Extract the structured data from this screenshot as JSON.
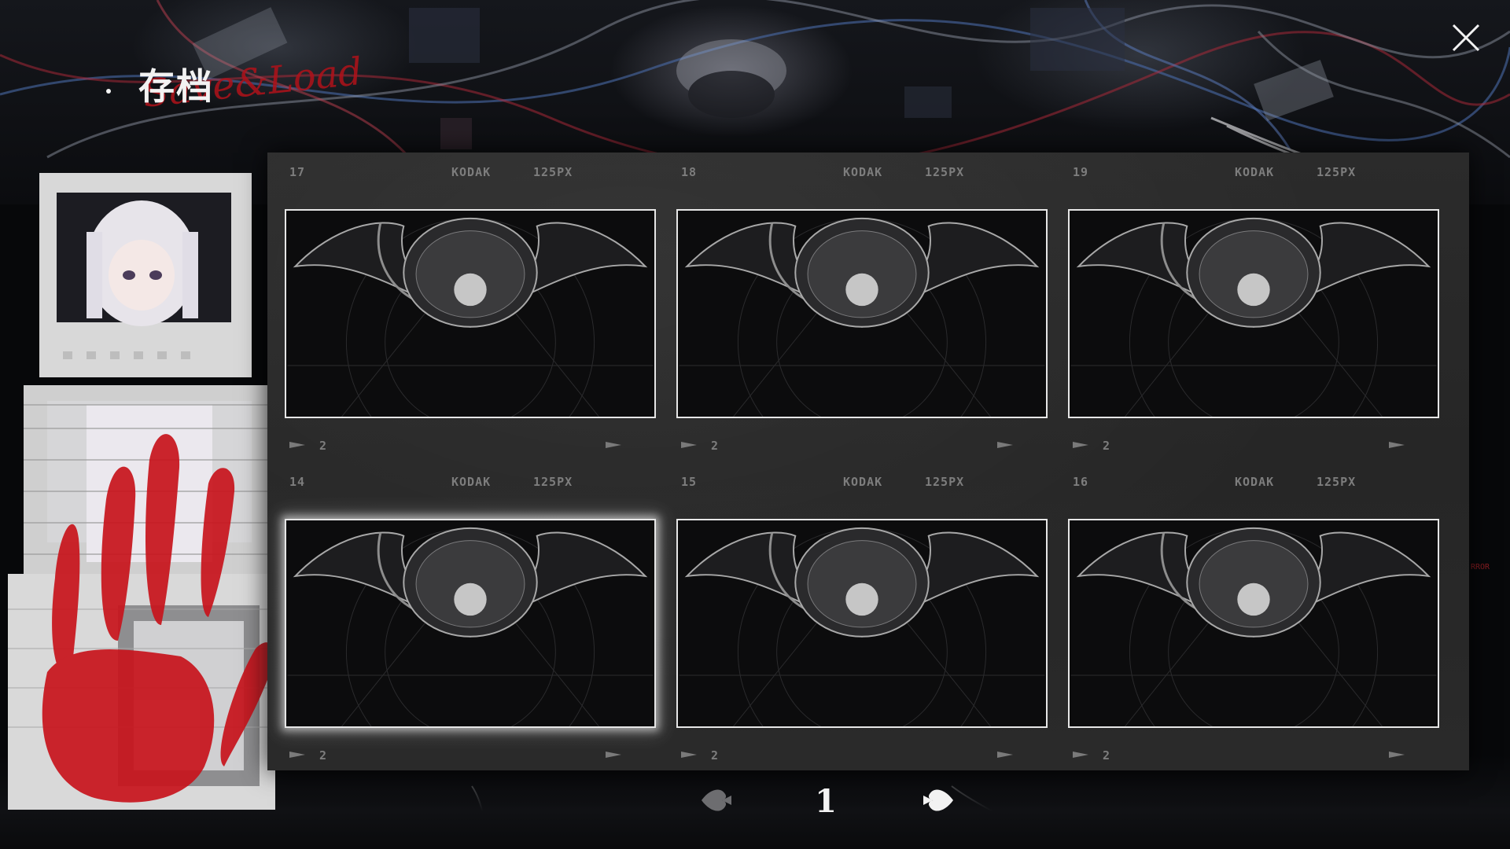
{
  "header": {
    "title": "存档",
    "subtitle": "Save&Load"
  },
  "slots": [
    {
      "number": "17",
      "brand": "KODAK",
      "film": "125PX",
      "frame": "2"
    },
    {
      "number": "18",
      "brand": "KODAK",
      "film": "125PX",
      "frame": "2"
    },
    {
      "number": "19",
      "brand": "KODAK",
      "film": "125PX",
      "frame": "2"
    },
    {
      "number": "14",
      "brand": "KODAK",
      "film": "125PX",
      "frame": "2"
    },
    {
      "number": "15",
      "brand": "KODAK",
      "film": "125PX",
      "frame": "2"
    },
    {
      "number": "16",
      "brand": "KODAK",
      "film": "125PX",
      "frame": "2"
    }
  ],
  "selected_slot": "14",
  "pager": {
    "page": "1"
  },
  "decor": {
    "error_text": "RROR"
  },
  "colors": {
    "accent_red": "#b0121a",
    "panel": "#282828",
    "frame_border": "#e6e6e6"
  },
  "icons": {
    "close": "close-icon",
    "prev": "spade-prev-icon",
    "next": "spade-next-icon",
    "logo": "crescent-logo-icon"
  }
}
